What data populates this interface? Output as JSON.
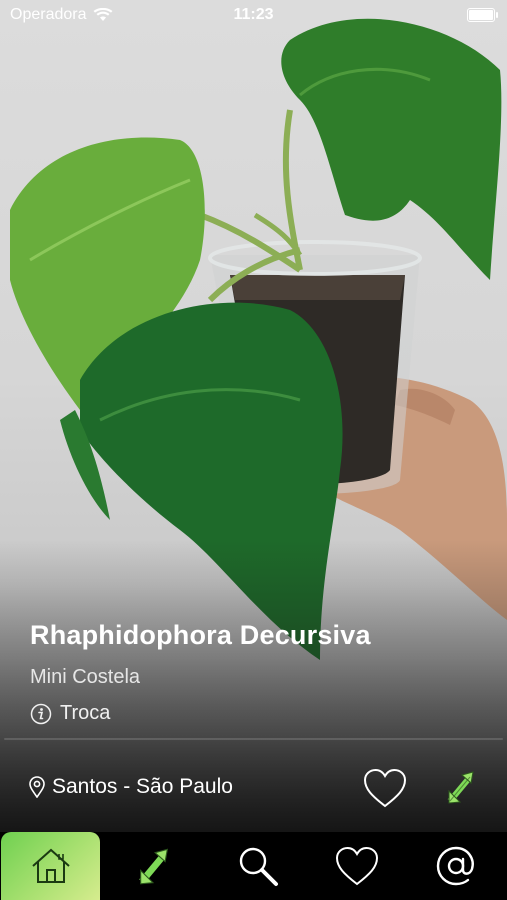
{
  "status_bar": {
    "carrier": "Operadora",
    "time": "11:23",
    "battery_level": 1.0
  },
  "plant": {
    "name": "Rhaphidophora Decursiva",
    "common_name": "Mini Costela",
    "listing_type": "Troca",
    "location": "Santos - São Paulo"
  },
  "actions": {
    "favorite_icon": "heart-outline-icon",
    "swap_icon": "swap-arrows-icon"
  },
  "tabbar": {
    "active_index": 0,
    "tabs": [
      {
        "name": "home",
        "icon": "home-icon"
      },
      {
        "name": "swap",
        "icon": "swap-arrows-icon"
      },
      {
        "name": "search",
        "icon": "search-icon"
      },
      {
        "name": "favorites",
        "icon": "heart-icon"
      },
      {
        "name": "contact",
        "icon": "at-icon"
      }
    ]
  },
  "colors": {
    "accent_green": "#7ed957",
    "accent_light": "#d6ec8e"
  }
}
